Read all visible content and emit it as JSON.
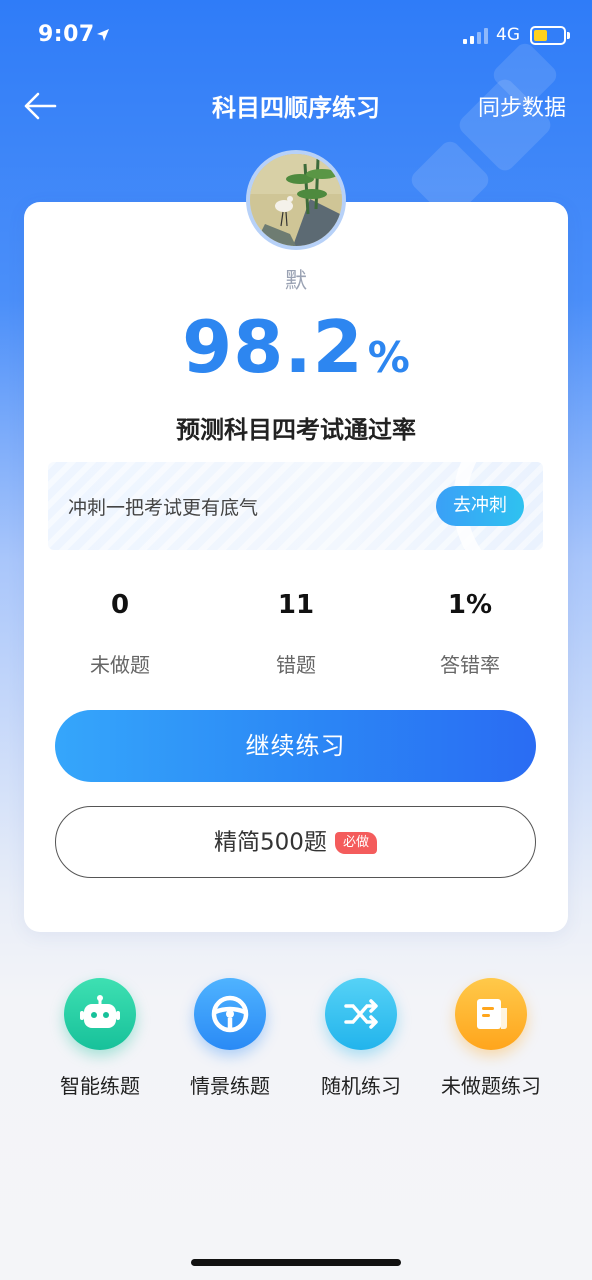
{
  "status_bar": {
    "time": "9:07",
    "network": "4G"
  },
  "nav": {
    "title": "科目四顺序练习",
    "sync": "同步数据"
  },
  "profile": {
    "name": "默"
  },
  "prediction": {
    "value": "98.2",
    "unit": "%",
    "label": "预测科目四考试通过率"
  },
  "banner": {
    "text": "冲刺一把考试更有底气",
    "button": "去冲刺"
  },
  "stats": [
    {
      "value": "0",
      "label": "未做题"
    },
    {
      "value": "11",
      "label": "错题"
    },
    {
      "value": "1%",
      "label": "答错率"
    }
  ],
  "actions": {
    "continue": "继续练习",
    "simple": "精简500题",
    "badge": "必做"
  },
  "tools": [
    {
      "label": "智能练题",
      "icon": "robot-icon"
    },
    {
      "label": "情景练题",
      "icon": "steering-wheel-icon"
    },
    {
      "label": "随机练习",
      "icon": "shuffle-icon"
    },
    {
      "label": "未做题练习",
      "icon": "document-icon"
    }
  ],
  "colors": {
    "primary": "#2d86f0",
    "badge": "#f45c5c"
  }
}
